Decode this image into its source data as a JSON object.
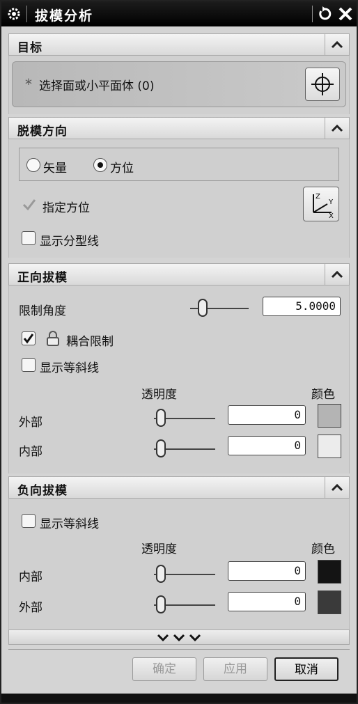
{
  "window": {
    "title": "拔模分析"
  },
  "sections": {
    "target": {
      "title": "目标",
      "select_label": "选择面或小平面体 (0)",
      "required_mark": "*"
    },
    "draw_direction": {
      "title": "脱模方向",
      "radio_vector": "矢量",
      "radio_orientation": "方位",
      "specify_label": "指定方位",
      "show_parting_label": "显示分型线"
    },
    "positive": {
      "title": "正向拔模",
      "limit_angle_label": "限制角度",
      "limit_angle_value": "5.0000",
      "coupled_label": "耦合限制",
      "show_isocline_label": "显示等斜线",
      "transparency_header": "透明度",
      "color_header": "颜色",
      "rows": [
        {
          "label": "外部",
          "value": "0",
          "color": "#b4b4b4"
        },
        {
          "label": "内部",
          "value": "0",
          "color": "#ececec"
        }
      ]
    },
    "negative": {
      "title": "负向拔模",
      "show_isocline_label": "显示等斜线",
      "transparency_header": "透明度",
      "color_header": "颜色",
      "rows": [
        {
          "label": "内部",
          "value": "0",
          "color": "#141414"
        },
        {
          "label": "外部",
          "value": "0",
          "color": "#3a3a3a"
        }
      ]
    }
  },
  "footer": {
    "ok": "确定",
    "apply": "应用",
    "cancel": "取消"
  }
}
